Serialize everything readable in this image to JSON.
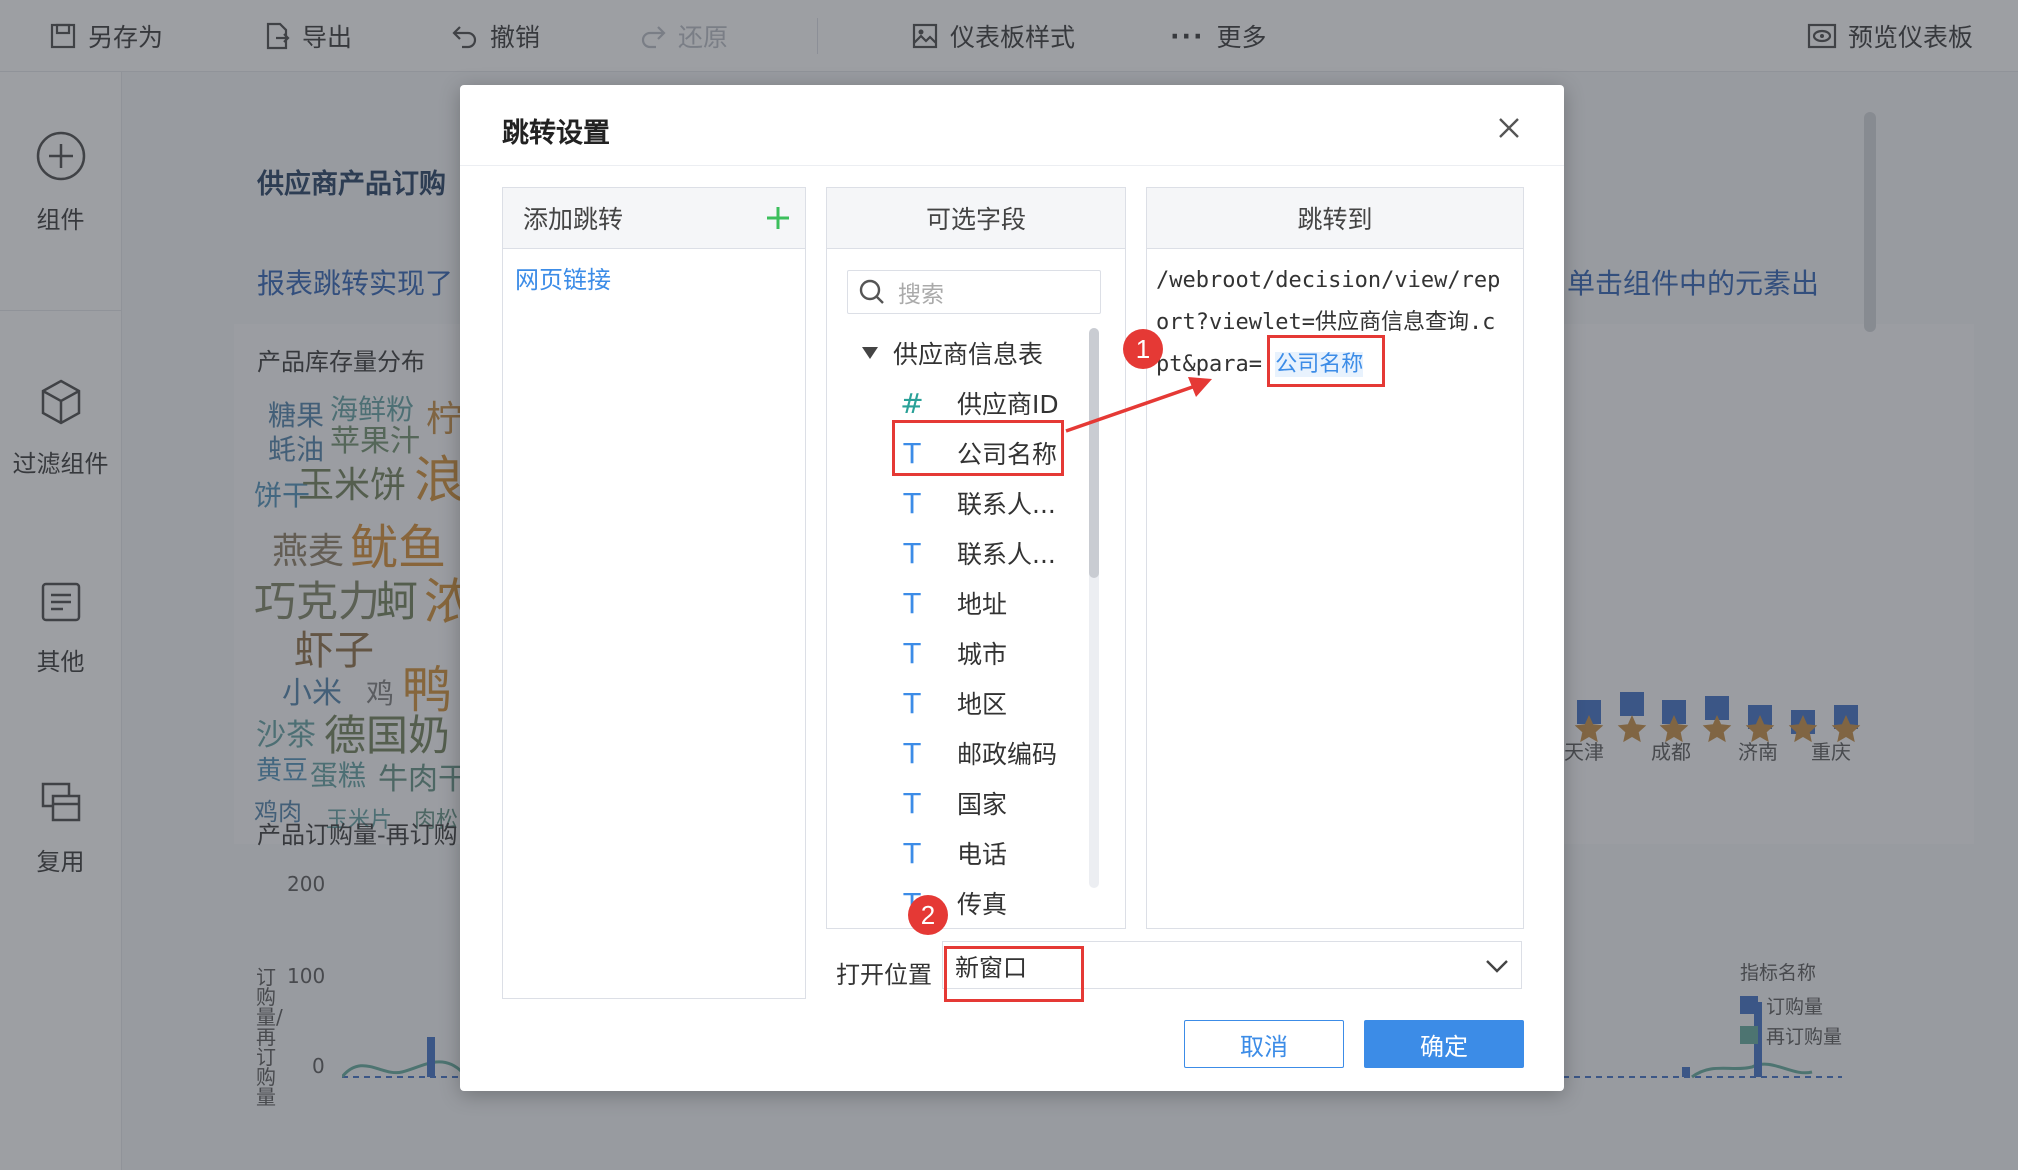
{
  "toolbar": {
    "save_as": "另存为",
    "export": "导出",
    "undo": "撤销",
    "redo": "还原",
    "dashboard_style": "仪表板样式",
    "more": "更多",
    "preview": "预览仪表板"
  },
  "sidebar": {
    "items": [
      {
        "label": "组件",
        "icon": "plus-circle-icon"
      },
      {
        "label": "过滤组件",
        "icon": "cube-icon"
      },
      {
        "label": "其他",
        "icon": "text-document-icon"
      },
      {
        "label": "复用",
        "icon": "copy-layers-icon"
      }
    ]
  },
  "background": {
    "title": "供应商产品订购",
    "description_left": "报表跳转实现了",
    "description_right": "单击组件中的元素出",
    "inventory_title": "产品库存量分布",
    "order_title": "产品订购量-再订购",
    "word_cloud": [
      "糖果",
      "海鲜粉",
      "柠",
      "蚝油",
      "苹果汁",
      "饼干",
      "玉米饼",
      "浪",
      "燕麦",
      "鱿鱼",
      "巧克力",
      "蚵",
      "浓",
      "虾子",
      "小米",
      "鸡",
      "鸭",
      "沙茶",
      "德国奶",
      "黄豆",
      "蛋糕",
      "牛肉干",
      "鸡肉",
      "玉米片",
      "肉松"
    ],
    "city_labels": [
      "天津",
      "成都",
      "济南",
      "重庆"
    ],
    "y_ticks": [
      "200",
      "100",
      "0"
    ],
    "y_axis_label": "订购量/再订购量",
    "legend_title": "指标名称",
    "legend_items": [
      {
        "label": "订购量",
        "color": "#3b6cc5"
      },
      {
        "label": "再订购量",
        "color": "#5fa89a"
      }
    ]
  },
  "dialog": {
    "title": "跳转设置",
    "add_jump_header": "添加跳转",
    "jump_items": [
      "网页链接"
    ],
    "fields_header": "可选字段",
    "search_placeholder": "搜索",
    "table_name": "供应商信息表",
    "fields": [
      {
        "type": "#",
        "name": "供应商ID"
      },
      {
        "type": "T",
        "name": "公司名称"
      },
      {
        "type": "T",
        "name": "联系人..."
      },
      {
        "type": "T",
        "name": "联系人..."
      },
      {
        "type": "T",
        "name": "地址"
      },
      {
        "type": "T",
        "name": "城市"
      },
      {
        "type": "T",
        "name": "地区"
      },
      {
        "type": "T",
        "name": "邮政编码"
      },
      {
        "type": "T",
        "name": "国家"
      },
      {
        "type": "T",
        "name": "电话"
      },
      {
        "type": "T",
        "name": "传真"
      }
    ],
    "target_header": "跳转到",
    "url_line1": "/webroot/decision/view/rep",
    "url_line2": "ort?viewlet=供应商信息查询.c",
    "url_line3_prefix": "pt&para=",
    "url_param": "公司名称",
    "open_position_label": "打开位置",
    "open_position_value": "新窗口",
    "cancel": "取消",
    "confirm": "确定",
    "step_badges": [
      "1",
      "2"
    ]
  },
  "colors": {
    "accent": "#3c8ce7",
    "primary_button": "#3c8ce7",
    "annotation_red": "#e53935",
    "add_green": "#3cbf5c"
  }
}
